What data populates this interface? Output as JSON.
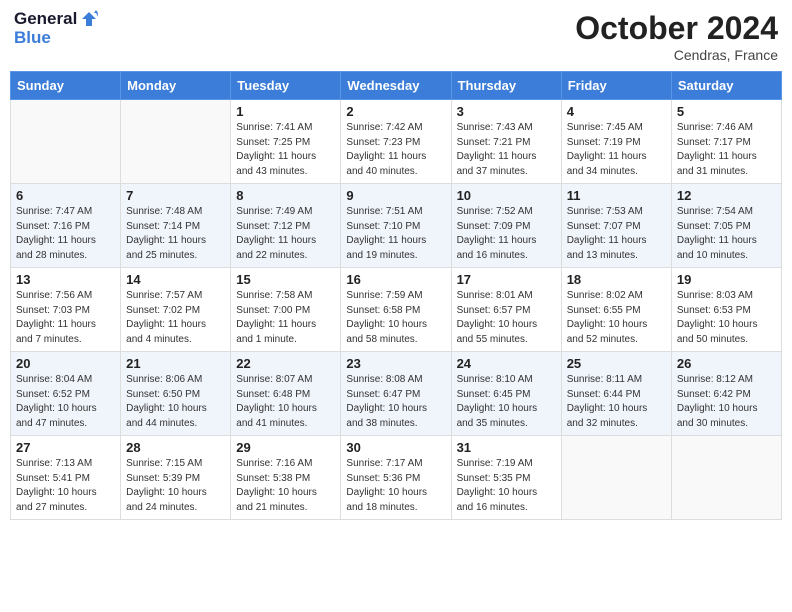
{
  "logo": {
    "line1": "General",
    "line2": "Blue"
  },
  "title": "October 2024",
  "location": "Cendras, France",
  "weekdays": [
    "Sunday",
    "Monday",
    "Tuesday",
    "Wednesday",
    "Thursday",
    "Friday",
    "Saturday"
  ],
  "weeks": [
    [
      {
        "day": "",
        "info": ""
      },
      {
        "day": "",
        "info": ""
      },
      {
        "day": "1",
        "info": "Sunrise: 7:41 AM\nSunset: 7:25 PM\nDaylight: 11 hours\nand 43 minutes."
      },
      {
        "day": "2",
        "info": "Sunrise: 7:42 AM\nSunset: 7:23 PM\nDaylight: 11 hours\nand 40 minutes."
      },
      {
        "day": "3",
        "info": "Sunrise: 7:43 AM\nSunset: 7:21 PM\nDaylight: 11 hours\nand 37 minutes."
      },
      {
        "day": "4",
        "info": "Sunrise: 7:45 AM\nSunset: 7:19 PM\nDaylight: 11 hours\nand 34 minutes."
      },
      {
        "day": "5",
        "info": "Sunrise: 7:46 AM\nSunset: 7:17 PM\nDaylight: 11 hours\nand 31 minutes."
      }
    ],
    [
      {
        "day": "6",
        "info": "Sunrise: 7:47 AM\nSunset: 7:16 PM\nDaylight: 11 hours\nand 28 minutes."
      },
      {
        "day": "7",
        "info": "Sunrise: 7:48 AM\nSunset: 7:14 PM\nDaylight: 11 hours\nand 25 minutes."
      },
      {
        "day": "8",
        "info": "Sunrise: 7:49 AM\nSunset: 7:12 PM\nDaylight: 11 hours\nand 22 minutes."
      },
      {
        "day": "9",
        "info": "Sunrise: 7:51 AM\nSunset: 7:10 PM\nDaylight: 11 hours\nand 19 minutes."
      },
      {
        "day": "10",
        "info": "Sunrise: 7:52 AM\nSunset: 7:09 PM\nDaylight: 11 hours\nand 16 minutes."
      },
      {
        "day": "11",
        "info": "Sunrise: 7:53 AM\nSunset: 7:07 PM\nDaylight: 11 hours\nand 13 minutes."
      },
      {
        "day": "12",
        "info": "Sunrise: 7:54 AM\nSunset: 7:05 PM\nDaylight: 11 hours\nand 10 minutes."
      }
    ],
    [
      {
        "day": "13",
        "info": "Sunrise: 7:56 AM\nSunset: 7:03 PM\nDaylight: 11 hours\nand 7 minutes."
      },
      {
        "day": "14",
        "info": "Sunrise: 7:57 AM\nSunset: 7:02 PM\nDaylight: 11 hours\nand 4 minutes."
      },
      {
        "day": "15",
        "info": "Sunrise: 7:58 AM\nSunset: 7:00 PM\nDaylight: 11 hours\nand 1 minute."
      },
      {
        "day": "16",
        "info": "Sunrise: 7:59 AM\nSunset: 6:58 PM\nDaylight: 10 hours\nand 58 minutes."
      },
      {
        "day": "17",
        "info": "Sunrise: 8:01 AM\nSunset: 6:57 PM\nDaylight: 10 hours\nand 55 minutes."
      },
      {
        "day": "18",
        "info": "Sunrise: 8:02 AM\nSunset: 6:55 PM\nDaylight: 10 hours\nand 52 minutes."
      },
      {
        "day": "19",
        "info": "Sunrise: 8:03 AM\nSunset: 6:53 PM\nDaylight: 10 hours\nand 50 minutes."
      }
    ],
    [
      {
        "day": "20",
        "info": "Sunrise: 8:04 AM\nSunset: 6:52 PM\nDaylight: 10 hours\nand 47 minutes."
      },
      {
        "day": "21",
        "info": "Sunrise: 8:06 AM\nSunset: 6:50 PM\nDaylight: 10 hours\nand 44 minutes."
      },
      {
        "day": "22",
        "info": "Sunrise: 8:07 AM\nSunset: 6:48 PM\nDaylight: 10 hours\nand 41 minutes."
      },
      {
        "day": "23",
        "info": "Sunrise: 8:08 AM\nSunset: 6:47 PM\nDaylight: 10 hours\nand 38 minutes."
      },
      {
        "day": "24",
        "info": "Sunrise: 8:10 AM\nSunset: 6:45 PM\nDaylight: 10 hours\nand 35 minutes."
      },
      {
        "day": "25",
        "info": "Sunrise: 8:11 AM\nSunset: 6:44 PM\nDaylight: 10 hours\nand 32 minutes."
      },
      {
        "day": "26",
        "info": "Sunrise: 8:12 AM\nSunset: 6:42 PM\nDaylight: 10 hours\nand 30 minutes."
      }
    ],
    [
      {
        "day": "27",
        "info": "Sunrise: 7:13 AM\nSunset: 5:41 PM\nDaylight: 10 hours\nand 27 minutes."
      },
      {
        "day": "28",
        "info": "Sunrise: 7:15 AM\nSunset: 5:39 PM\nDaylight: 10 hours\nand 24 minutes."
      },
      {
        "day": "29",
        "info": "Sunrise: 7:16 AM\nSunset: 5:38 PM\nDaylight: 10 hours\nand 21 minutes."
      },
      {
        "day": "30",
        "info": "Sunrise: 7:17 AM\nSunset: 5:36 PM\nDaylight: 10 hours\nand 18 minutes."
      },
      {
        "day": "31",
        "info": "Sunrise: 7:19 AM\nSunset: 5:35 PM\nDaylight: 10 hours\nand 16 minutes."
      },
      {
        "day": "",
        "info": ""
      },
      {
        "day": "",
        "info": ""
      }
    ]
  ],
  "shaded_rows": [
    1,
    3
  ]
}
